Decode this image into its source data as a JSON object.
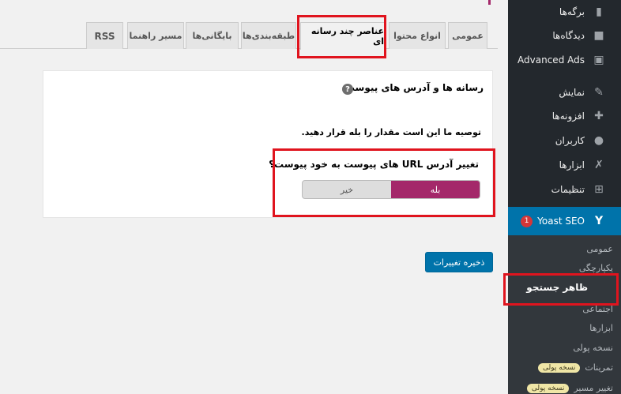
{
  "tabs": [
    {
      "label": "عمومی"
    },
    {
      "label": "انواع محتوا"
    },
    {
      "label": "عناصر چند رسانه ای"
    },
    {
      "label": "طبقه‌بندی‌ها"
    },
    {
      "label": "بایگانی‌ها"
    },
    {
      "label": "مسیر راهنما"
    },
    {
      "label": "RSS"
    }
  ],
  "card": {
    "title": "رسانه ها و آدرس های پیوست",
    "help_icon": "?",
    "recommendation": "توصیه ما این است مقدار را بله قرار دهید.",
    "question": "تغییر آدرس URL های پیوست به خود پیوست؟",
    "toggle": {
      "yes": "بله",
      "no": "خیر",
      "selected": "yes"
    }
  },
  "save_button": "ذخیره تغییرات",
  "sidebar": {
    "items": [
      {
        "label": "برگه‌ها",
        "icon": "pages-icon"
      },
      {
        "label": "دیدگاه‌ها",
        "icon": "comments-icon"
      },
      {
        "label": "Advanced Ads",
        "icon": "ads-icon"
      },
      {
        "label": "نمایش",
        "icon": "appearance-icon"
      },
      {
        "label": "افزونه‌ها",
        "icon": "plugins-icon"
      },
      {
        "label": "کاربران",
        "icon": "users-icon"
      },
      {
        "label": "ابزارها",
        "icon": "tools-icon"
      },
      {
        "label": "تنظیمات",
        "icon": "settings-icon"
      }
    ],
    "yoast": {
      "label": "Yoast SEO",
      "badge": "1",
      "icon": "yoast-icon"
    },
    "submenu": [
      {
        "label": "عمومی"
      },
      {
        "label": "یکپارچگی"
      },
      {
        "label": "ظاهر جستجو"
      },
      {
        "label": "اجتماعی"
      },
      {
        "label": "ابزارها"
      },
      {
        "label": "نسخه پولی"
      },
      {
        "label": "تمرینات",
        "badge": "نسخه پولی"
      },
      {
        "label": "تغییر مسیر",
        "badge": "نسخه پولی"
      }
    ]
  }
}
